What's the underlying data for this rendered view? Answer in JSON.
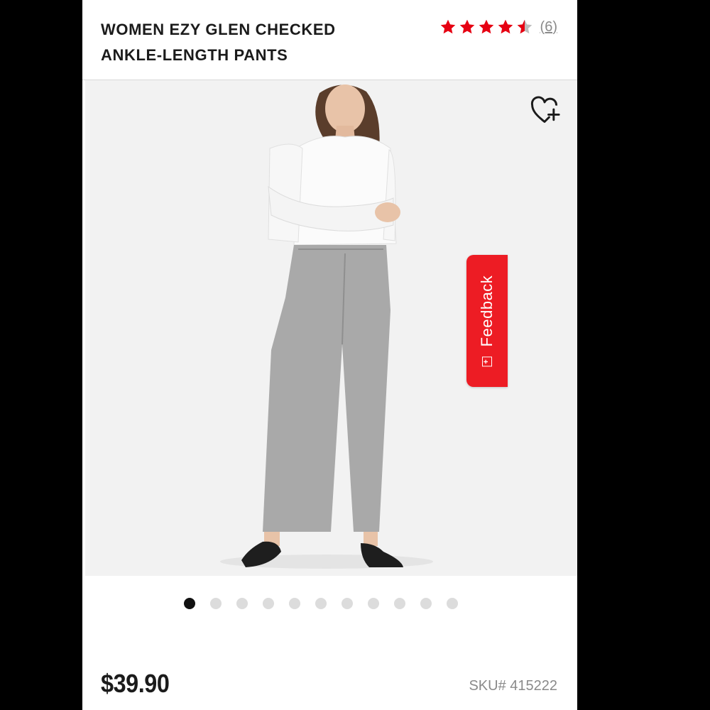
{
  "product": {
    "title": "WOMEN EZY GLEN CHECKED\nANKLE-LENGTH PANTS",
    "rating": 4.5,
    "review_count": "(6)",
    "price": "$39.90",
    "sku": "SKU# 415222"
  },
  "gallery": {
    "total_images": 11,
    "active_index": 0
  },
  "feedback": {
    "label": "Feedback",
    "icon_glyph": "+"
  },
  "icons": {
    "wishlist": "heart-plus-icon",
    "star_full": "star-icon",
    "star_half": "half-star-icon",
    "feedback": "feedback-plus-icon"
  },
  "colors": {
    "accent": "#ed1c24",
    "star": "#e60012",
    "star_empty": "#bdbdbd",
    "text_primary": "#1b1b1b",
    "text_secondary": "#8a8a8a",
    "image_bg": "#f2f2f2",
    "pants": "#a9a9a9",
    "shirt": "#fbfbfb",
    "dot_active": "#111111",
    "dot_inactive": "#dcdcdc"
  }
}
